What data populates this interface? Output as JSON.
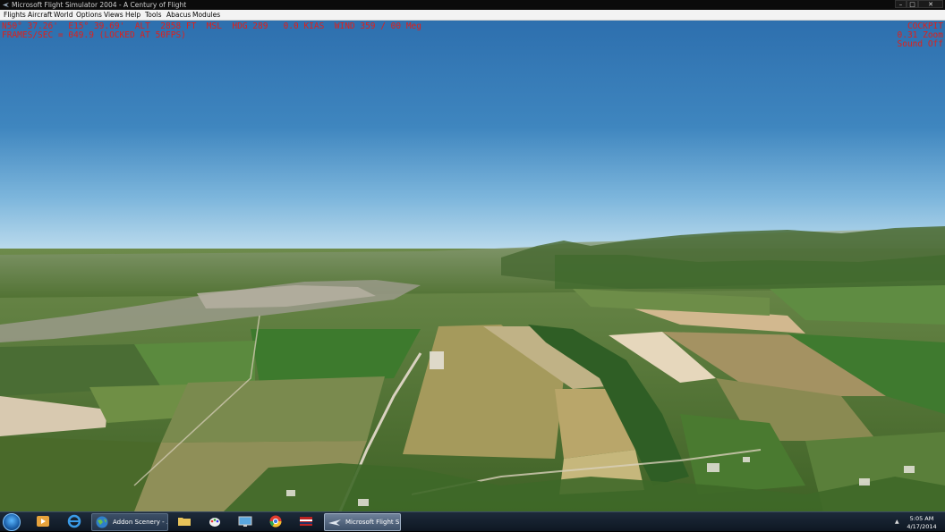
{
  "window": {
    "title": "Microsoft Flight Simulator 2004 - A Century of Flight",
    "controls": {
      "minimize": "–",
      "maximize": "□",
      "close": "✕"
    }
  },
  "menu": [
    "Flights",
    "Aircraft",
    "World",
    "Options",
    "Views",
    "Help",
    "Tools",
    "Abacus",
    "Modules"
  ],
  "hud": {
    "line1": "N50° 37.26'  E15° 39.69'  ALT  2858 FT  MSL  HDG 289   0.0 KIAS  WIND 359 / 00 Meg",
    "line2": "FRAMES/SEC = 049.9 (LOCKED AT 50FPS)",
    "view": "COCKPIT",
    "zoom": "0.31 Zoom",
    "sound": "Sound Off"
  },
  "colors": {
    "hud_text": "#e0201a",
    "sky_top": "#2d6fae",
    "sky_horizon": "#b9d9ec",
    "ground": "#5d7d3a"
  },
  "taskbar": {
    "pinned_icons": [
      "media-player-icon",
      "internet-explorer-icon",
      "folder-icon",
      "paint-icon",
      "display-icon",
      "chrome-icon",
      "flag-icon"
    ],
    "tasks": [
      {
        "label": "Addon Scenery - ...",
        "icon": "globe-icon",
        "active": false
      },
      {
        "label": "Microsoft Flight S...",
        "icon": "airplane-icon",
        "active": true
      }
    ],
    "clock_time": "5:05 AM",
    "clock_date": "4/17/2014"
  }
}
